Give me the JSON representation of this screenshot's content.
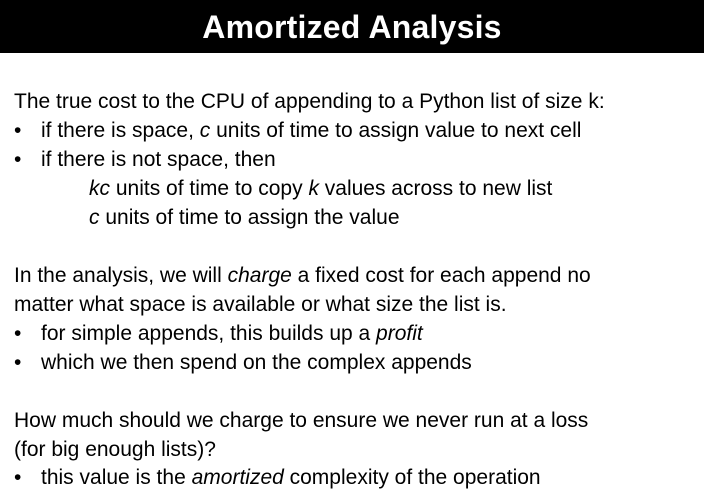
{
  "slide": {
    "title": "Amortized Analysis"
  },
  "para1": {
    "intro": "The true cost to the CPU of appending to a Python list of size k:",
    "bullet1": {
      "pre": "if there is space, ",
      "em": "c",
      "post": " units of time to assign value to next cell"
    },
    "bullet2": "if there is not space, then",
    "sub1": {
      "em1": "kc",
      "mid": " units of time to copy ",
      "em2": "k",
      "post": " values across to new list"
    },
    "sub2": {
      "em": "c",
      "post": " units of time to assign the value"
    }
  },
  "para2": {
    "line1": {
      "pre": "In the analysis, we will ",
      "em": "charge",
      "post": " a fixed cost for each append no"
    },
    "line2": "matter what space is available or what size the list is.",
    "bullet1": {
      "pre": "for simple appends, this builds up a ",
      "em": "profit"
    },
    "bullet2": "which we then spend on the complex appends"
  },
  "para3": {
    "line1": "How much should we charge to ensure we never run at a loss",
    "line2": "(for big enough lists)?",
    "bullet1": {
      "pre": "this value is the ",
      "em": "amortized",
      "post": " complexity of the operation"
    }
  },
  "bullet_symbol": "•"
}
